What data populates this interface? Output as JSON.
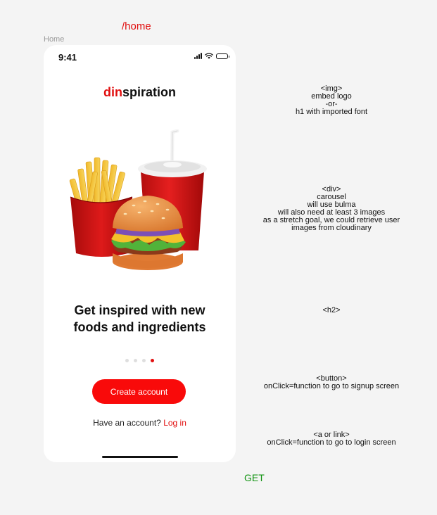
{
  "canvas": {
    "route": "/home",
    "frame_label": "Home",
    "method": "GET"
  },
  "status_bar": {
    "time": "9:41",
    "icons": [
      "cellular-signal-icon",
      "wifi-icon",
      "battery-icon"
    ]
  },
  "app": {
    "logo_accent": "din",
    "logo_rest": "spiration",
    "hero_image": "burger-fries-soda-illustration",
    "headline_line1": "Get inspired with new",
    "headline_line2": "foods and ingredients",
    "carousel": {
      "slides": 4,
      "active": 4
    },
    "create_account_label": "Create account",
    "login_prompt": "Have an account?",
    "login_label": "Log in"
  },
  "annotations": {
    "logo": "<img>\nembed logo\n-or-\nh1 with imported font",
    "carousel": "<div>\ncarousel\nwill use bulma\nwill also need at least 3 images\nas a stretch goal, we could retrieve user\nimages from cloudinary",
    "headline": "<h2>",
    "button": "<button>\nonClick=function to go to signup screen",
    "link": "<a or link>\nonClick=function to go to login screen"
  },
  "colors": {
    "accent": "#e10f0f",
    "button": "#f90a0a",
    "method": "#139413",
    "canvas_bg": "#f4f4f4"
  }
}
